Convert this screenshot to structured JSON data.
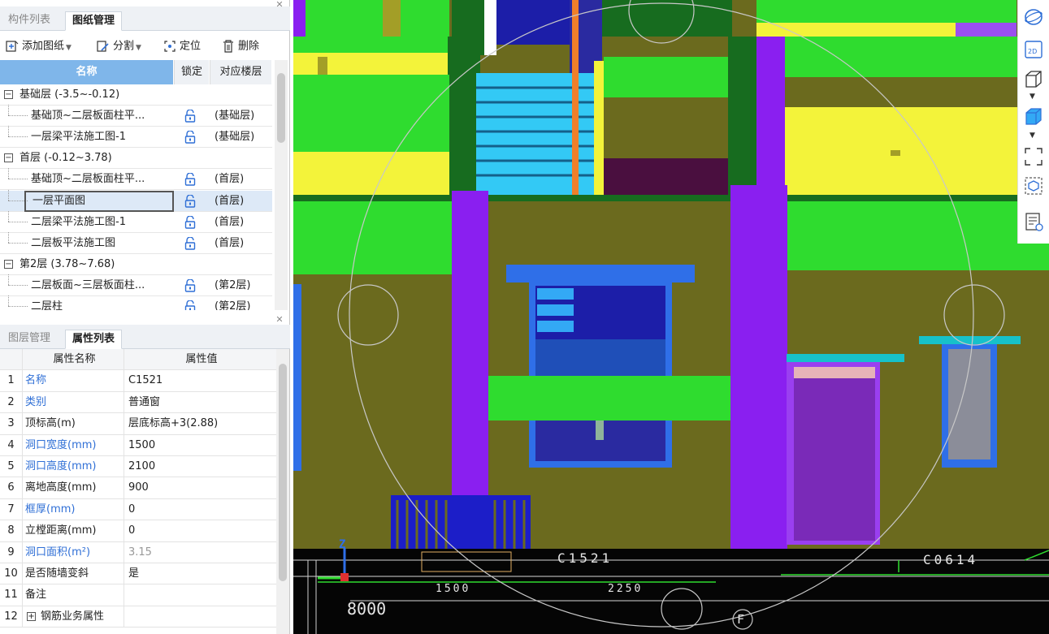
{
  "panel1": {
    "tabs": [
      "构件列表",
      "图纸管理"
    ],
    "active_tab": 1,
    "toolbar": {
      "add_drawing": "添加图纸",
      "split": "分割",
      "locate": "定位",
      "delete": "删除"
    },
    "columns": [
      "名称",
      "锁定",
      "对应楼层"
    ],
    "rows": [
      {
        "type": "group",
        "label": "基础层 (-3.5~-0.12)"
      },
      {
        "type": "item",
        "name": "基础顶~二层板面柱平...",
        "floor": "(基础层)"
      },
      {
        "type": "item",
        "name": "一层梁平法施工图-1",
        "floor": "(基础层)"
      },
      {
        "type": "group",
        "label": "首层 (-0.12~3.78)"
      },
      {
        "type": "item",
        "name": "基础顶~二层板面柱平...",
        "floor": "(首层)"
      },
      {
        "type": "item",
        "name": "一层平面图",
        "floor": "(首层)",
        "selected": true
      },
      {
        "type": "item",
        "name": "二层梁平法施工图-1",
        "floor": "(首层)"
      },
      {
        "type": "item",
        "name": "二层板平法施工图",
        "floor": "(首层)"
      },
      {
        "type": "group",
        "label": "第2层 (3.78~7.68)"
      },
      {
        "type": "item",
        "name": "二层板面~三层板面柱...",
        "floor": "(第2层)"
      },
      {
        "type": "item",
        "name": "二层柱",
        "floor": "(第2层)"
      }
    ]
  },
  "panel2": {
    "tabs": [
      "图层管理",
      "属性列表"
    ],
    "active_tab": 1,
    "columns": [
      "属性名称",
      "属性值"
    ],
    "rows": [
      {
        "num": "1",
        "name": "名称",
        "value": "C1521",
        "blue": true
      },
      {
        "num": "2",
        "name": "类别",
        "value": "普通窗",
        "blue": true
      },
      {
        "num": "3",
        "name": "顶标高(m)",
        "value": "层底标高+3(2.88)",
        "blue": false
      },
      {
        "num": "4",
        "name": "洞口宽度(mm)",
        "value": "1500",
        "blue": true
      },
      {
        "num": "5",
        "name": "洞口高度(mm)",
        "value": "2100",
        "blue": true
      },
      {
        "num": "6",
        "name": "离地高度(mm)",
        "value": "900",
        "blue": false
      },
      {
        "num": "7",
        "name": "框厚(mm)",
        "value": "0",
        "blue": true
      },
      {
        "num": "8",
        "name": "立樘距离(mm)",
        "value": "0",
        "blue": false
      },
      {
        "num": "9",
        "name": "洞口面积(m²)",
        "value": "3.15",
        "blue": true,
        "value_gray": true
      },
      {
        "num": "10",
        "name": "是否随墙变斜",
        "value": "是",
        "blue": false
      },
      {
        "num": "11",
        "name": "备注",
        "value": "",
        "blue": false
      },
      {
        "num": "12",
        "name": "钢筋业务属性",
        "value": "",
        "blue": false,
        "expandable": true
      }
    ]
  },
  "canvas": {
    "labels": {
      "window1": "C1521",
      "window2": "C0614",
      "dim1": "1500",
      "dim2": "2250",
      "dim3": "8000",
      "axis_z": "Z",
      "axis_f": "F"
    }
  },
  "colors": {
    "wall": "#6b6a1e",
    "beam_green": "#2fdc2f",
    "yellow": "#f3f33a",
    "purple": "#8a1ff0",
    "blue_window": "#2f6fe8",
    "cyan": "#33c9f5",
    "teal": "#17c1c9"
  }
}
